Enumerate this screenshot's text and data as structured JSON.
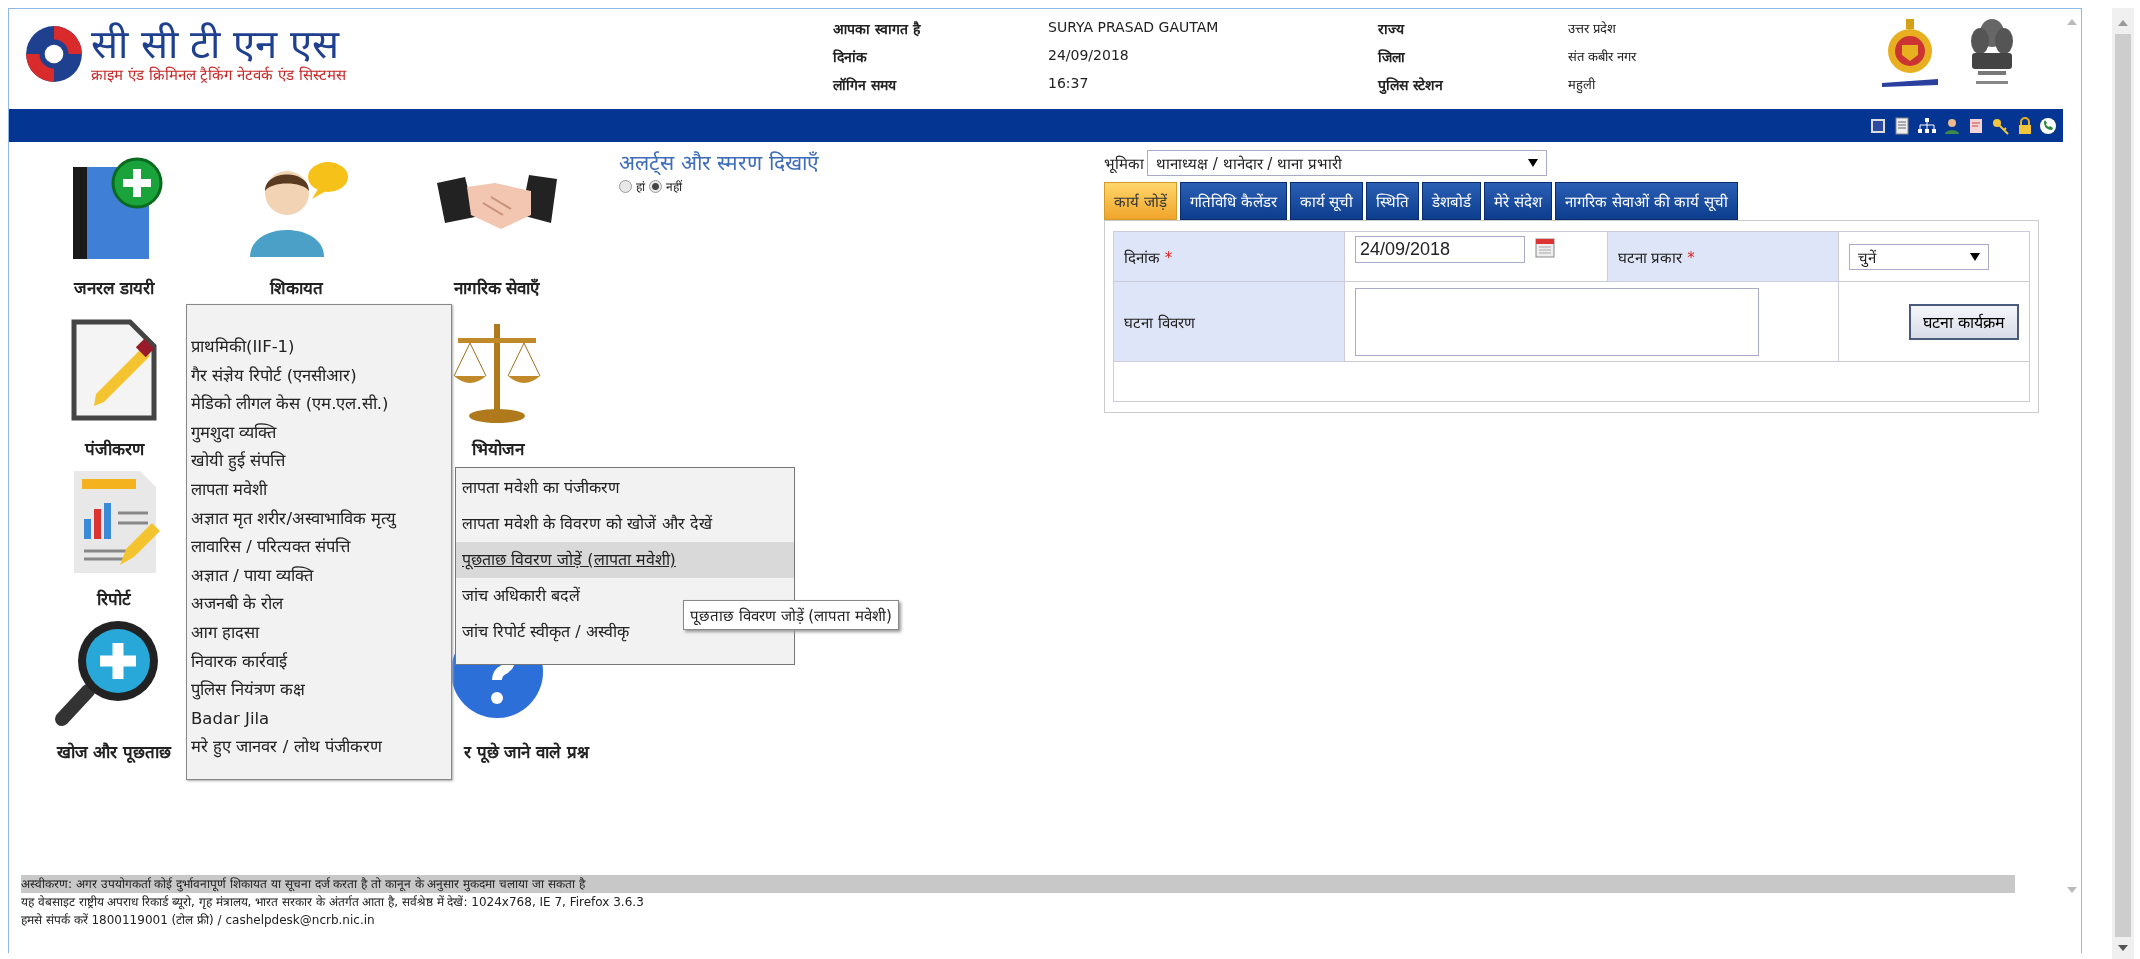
{
  "header": {
    "logo_title": "सी सी टी एन एस",
    "logo_subtitle": "क्राइम एंड क्रिमिनल ट्रैकिंग नेटवर्क एंड सिस्टमस",
    "info": [
      {
        "label": "आपका स्वागत है",
        "value": "SURYA PRASAD GAUTAM"
      },
      {
        "label": "दिनांक",
        "value": "24/09/2018"
      },
      {
        "label": "लॉगिन समय",
        "value": "16:37"
      }
    ],
    "location": [
      {
        "label": "राज्य",
        "value": "उत्तर प्रदेश"
      },
      {
        "label": "जिला",
        "value": "संत कबीर नगर"
      },
      {
        "label": "पुलिस स्टेशन",
        "value": "महुली"
      }
    ]
  },
  "modules": [
    {
      "kind": "diary",
      "label": "जनरल डायरी"
    },
    {
      "kind": "complaint",
      "label": "शिकायत"
    },
    {
      "kind": "citizen",
      "label": "नागरिक सेवाएँ"
    },
    {
      "kind": "registration",
      "label": "पंजीकरण"
    },
    {
      "kind": "prosecution",
      "label": "भियोजन"
    },
    {
      "kind": "report",
      "label": "रिपोर्ट"
    },
    {
      "kind": "search",
      "label": "खोज और पूछताछ"
    },
    {
      "kind": "faq",
      "label": "र पूछे जाने वाले प्रश्न"
    }
  ],
  "alerts": {
    "title": "अलर्ट्स और स्मरण दिखाएँ",
    "options": [
      {
        "label": "हां",
        "selected": false
      },
      {
        "label": "नहीं",
        "selected": true
      }
    ]
  },
  "menu": {
    "items": [
      "प्राथमिकी(IIF-1)",
      "गैर संज्ञेय रिपोर्ट (एनसीआर)",
      "मेडिको लीगल केस (एम.एल.सी.)",
      "गुमशुदा व्यक्ति",
      "खोयी हुई संपत्ति",
      "लापता मवेशी",
      "अज्ञात मृत शरीर/अस्वाभाविक मृत्यु",
      "लावारिस / परित्यक्त संपत्ति",
      "अज्ञात / पाया व्यक्ति",
      "अजनबी के रोल",
      "आग हादसा",
      "निवारक कार्रवाई",
      "पुलिस नियंत्रण कक्ष",
      "Badar Jila",
      "मरे हुए जानवर / लोथ पंजीकरण"
    ]
  },
  "submenu": {
    "items": [
      {
        "label": "लापता मवेशी का पंजीकरण",
        "selected": false
      },
      {
        "label": "लापता मवेशी के विवरण को खोजें और देखें",
        "selected": false
      },
      {
        "label": "पूछताछ विवरण जोड़ें (लापता मवेशी)",
        "selected": true
      },
      {
        "label": "जांच अधिकारी बदलें",
        "selected": false
      },
      {
        "label": "जांच रिपोर्ट स्वीकृत / अस्वीकृ",
        "selected": false
      }
    ]
  },
  "tooltip": "पूछताछ विवरण जोड़ें (लापता मवेशी)",
  "role": {
    "label": "भूमिका",
    "value": "थानाध्यक्ष / थानेदार / थाना प्रभारी"
  },
  "tabs": [
    {
      "label": "कार्य जोड़ें",
      "selected": true
    },
    {
      "label": "गतिविधि कैलेंडर",
      "selected": false
    },
    {
      "label": "कार्य सूची",
      "selected": false
    },
    {
      "label": "स्थिति",
      "selected": false
    },
    {
      "label": "डेशबोर्ड",
      "selected": false
    },
    {
      "label": "मेरे संदेश",
      "selected": false
    },
    {
      "label": "नागरिक सेवाओं की कार्य सूची",
      "selected": false
    }
  ],
  "form": {
    "date": {
      "label": "दिनांक",
      "required_mark": "*",
      "value": "24/09/2018"
    },
    "event_type": {
      "label": "घटना प्रकार",
      "required_mark": "*",
      "value": "चुनें"
    },
    "event_detail": {
      "label": "घटना विवरण"
    },
    "button": "घटना कार्यक्रम"
  },
  "footer": [
    "अस्वीकरण: अगर उपयोगकर्ता कोई दुर्भावनापूर्ण शिकायत या सूचना दर्ज करता है तो कानून के अनुसार मुकदमा चलाया जा सकता है",
    "यह वेबसाइट राष्ट्रीय अपराध रिकार्ड ब्यूरो, गृह मंत्रालय, भारत सरकार के अंतर्गत आता है, सर्वश्रेष्ठ में देखें: 1024x768, IE 7, Firefox 3.6.3",
    "हमसे संपर्क करें 1800119001 (टोल फ्री) / cashelpdesk@ncrb.nic.in"
  ]
}
